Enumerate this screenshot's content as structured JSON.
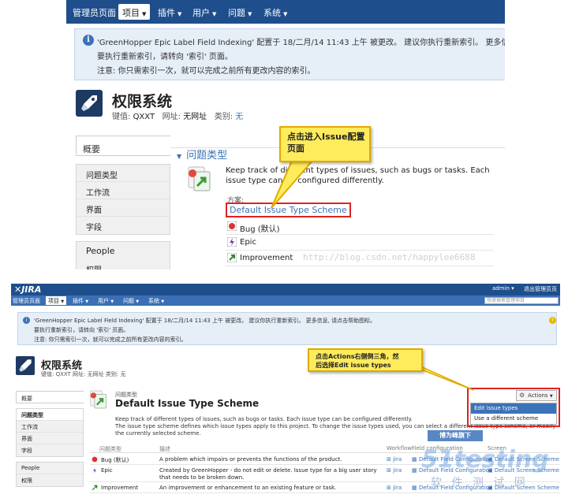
{
  "top": {
    "nav": [
      {
        "label": "管理员页面",
        "selected": false
      },
      {
        "label": "项目",
        "selected": true
      },
      {
        "label": "插件",
        "selected": false
      },
      {
        "label": "用户",
        "selected": false
      },
      {
        "label": "问题",
        "selected": false
      },
      {
        "label": "系统",
        "selected": false
      }
    ],
    "banner": {
      "line1": "'GreenHopper Epic Label Field Indexing' 配置于 18/二月/14 11:43 上午 被更改。 建议你执行重新索引。 更多信息, 请点击讯",
      "line2": "要执行重新索引，请转向 '索引' 页面。",
      "line3": "注意: 你只需索引一次，就可以完成之前所有更改内容的索引。"
    },
    "project": {
      "title": "权限系统",
      "key_label": "键值: ",
      "key": "QXXT",
      "url_label": "网址: ",
      "url": "无网址",
      "category_label": "类别: ",
      "category": "无"
    },
    "sidebar": {
      "summary_tab": "概要",
      "items": [
        "问题类型",
        "工作流",
        "界面",
        "字段"
      ],
      "section2": "People",
      "section2_item": "权限"
    },
    "section_heading": "问题类型",
    "description": "Keep track of different types of issues, such as bugs or tasks. Each issue type can be configured differently.",
    "scheme_label": "方案:",
    "scheme_link": "Default Issue Type Scheme",
    "issue_types": [
      {
        "label": "Bug (默认)",
        "icon": "bug-icon"
      },
      {
        "label": "Epic",
        "icon": "epic-icon"
      },
      {
        "label": "Improvement",
        "icon": "improvement-icon"
      }
    ],
    "callout": {
      "line1": "点击进入Issue配置",
      "line2": "页面"
    },
    "watermark": "http://blog.csdn.net/happylee6688"
  },
  "bottom": {
    "logo": "JIRA",
    "user": "admin",
    "exit": "退出管理员页",
    "nav": [
      {
        "label": "管理员页面",
        "selected": false
      },
      {
        "label": "项目",
        "selected": true
      },
      {
        "label": "插件",
        "selected": false
      },
      {
        "label": "用户",
        "selected": false
      },
      {
        "label": "问题",
        "selected": false
      },
      {
        "label": "系统",
        "selected": false
      }
    ],
    "search_placeholder": "快速搜索管理项目",
    "banner": {
      "line1": "'GreenHopper Epic Label Field Indexing' 配置于 18/二月/14 11:43 上午 被更改。 建议你执行重新索引。 更多信息, 请点击帮助图标。",
      "line2": "要执行重新索引，请转向 '索引' 页面。",
      "line3": "注意: 你只需索引一次，就可以完成之前所有更改内容的索引。"
    },
    "project": {
      "title": "权限系统",
      "meta": "键值: QXXT   网址: 无网址   类别: 无"
    },
    "sidebar": {
      "summary_tab": "概要",
      "items": [
        "问题类型",
        "工作流",
        "界面",
        "字段"
      ],
      "section2": "People",
      "section2_item": "权限"
    },
    "subheading": "问题类型",
    "title": "Default Issue Type Scheme",
    "desc1": "Keep track of different types of issues, such as bugs or tasks. Each issue type can be configured differently.",
    "desc2": "The issue type scheme defines which issue types apply to this project. To change the issue types used, you can select a different issue type scheme, or modify the currently selected scheme.",
    "actions_label": "Actions",
    "menu": [
      "Edit issue types",
      "Use a different scheme"
    ],
    "callout": {
      "line1": "点击Actions右侧倒三角，然",
      "line2": "后选择Edit issue types"
    },
    "columns": {
      "type": "问题类型",
      "desc": "描述",
      "workflow": "Workflow",
      "field": "Field configuration",
      "screen": "Screen"
    },
    "rows": [
      {
        "type": "Bug (默认)",
        "desc": "A problem which impairs or prevents the functions of the product.",
        "workflow": "jira",
        "field": "Default Field Configuration",
        "screen": "Default Screen Scheme",
        "icon": "bug-icon"
      },
      {
        "type": "Epic",
        "desc": "Created by GreenHopper - do not edit or delete. Issue type for a big user story that needs to be broken down.",
        "workflow": "jira",
        "field": "Default Field Configuration",
        "screen": "Default Screen Scheme",
        "icon": "epic-icon"
      },
      {
        "type": "Improvement",
        "desc": "An improvement or enhancement to an existing feature or task.",
        "workflow": "jira",
        "field": "Default Field Configuration",
        "screen": "Default Screen Scheme",
        "icon": "improvement-icon"
      }
    ],
    "watermark1": "博为峰旗下",
    "watermark2": "51testing",
    "watermark3": "软 件 测 试 网"
  }
}
